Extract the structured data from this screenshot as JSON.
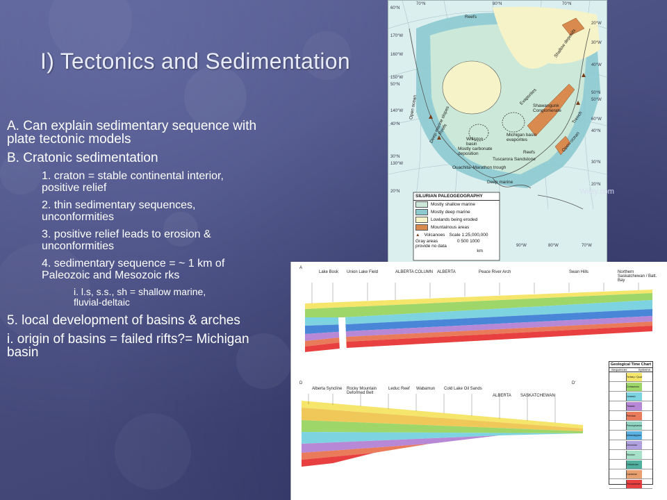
{
  "slide": {
    "title": "I) Tectonics and Sedimentation",
    "credit": "Wiley.com"
  },
  "body": {
    "point_a": "A. Can explain sedimentary sequence with plate tectonic models",
    "point_b": "B. Cratonic sedimentation",
    "sub_1": "1. craton = stable continental interior, positive relief",
    "sub_2": "2. thin sedimentary sequences, unconformities",
    "sub_3": "3. positive relief leads to erosion & unconformities",
    "sub_4": "4. sedimentary sequence = ~ 1 km of Paleozoic and Mesozoic rks",
    "sub_4_i": "i. l.s, s.s., sh = shallow marine, fluvial-deltaic",
    "point_5": "5. local development of basins & arches",
    "point_i": "i. origin of basins = failed rifts?= Michigan basin"
  },
  "map": {
    "legend_title": "SILURIAN PALEOGEOGRAPHY",
    "legend_items": [
      {
        "label": "Mostly shallow marine",
        "color": "#cbe8d8"
      },
      {
        "label": "Mostly deep marine",
        "color": "#8ccad0"
      },
      {
        "label": "Lowlands being eroded",
        "color": "#f7f3c8"
      },
      {
        "label": "Mountainous areas",
        "color": "#d98a4e"
      }
    ],
    "legend_volcanoes": "Volcanoes",
    "legend_gray": "Gray areas provide no data",
    "legend_scale": "Scale 1:25,000,000",
    "legend_scale_ticks": "0   500   1000",
    "legend_scale_unit": "km",
    "labels": {
      "reefs_top": "Reefs",
      "shallow_deposits": "Shallow deposits",
      "evaporites": "Evaporites",
      "shawangunk": "Shawangunk Conglomerate",
      "williston": "Williston basin",
      "michigan": "Michigan basin evaporites",
      "carbonate": "Mostly carbonate deposition",
      "tuscarora": "Tuscarora Sandstone",
      "ouachita": "Ouachita–Marathon trough",
      "deep_marine": "Deep marine",
      "open_ocean_left": "Open ocean",
      "open_ocean_right": "Open ocean",
      "deep_slopes": "Deep marine slopes",
      "reefs_mid": "Reefs",
      "reefs_low": "Reefs",
      "trench": "Trench"
    },
    "lat_left": [
      "60°N",
      "170°W",
      "160°W",
      "150°W",
      "50°N",
      "140°W",
      "40°N",
      "30°N",
      "130°W",
      "20°N"
    ],
    "lat_right": [
      "20°W",
      "30°W",
      "40°W",
      "50°N",
      "50°W",
      "60°W",
      "40°N",
      "30°N",
      "20°N"
    ],
    "lon_top": [
      "70°N",
      "80°N",
      "70°N"
    ],
    "lon_bottom": [
      "90°W",
      "80°W",
      "70°W"
    ]
  },
  "cross_section": {
    "label_a": "A",
    "label_d": "D",
    "label_d_prime": "D'",
    "chart_title": "Geological Time Chart",
    "chart_col1": "Sequences",
    "chart_col2": "Systems",
    "chart_units": [
      {
        "name": "Tertiary / Quaternary",
        "color": "#f5e66b"
      },
      {
        "name": "Cretaceous",
        "color": "#9ed66a"
      },
      {
        "name": "Jurassic",
        "color": "#7dd4e0"
      },
      {
        "name": "Triassic",
        "color": "#b788d6"
      },
      {
        "name": "Permian",
        "color": "#e97a5a"
      },
      {
        "name": "Pennsylvanian",
        "color": "#8fd3c0"
      },
      {
        "name": "Mississippian",
        "color": "#5ab0e0"
      },
      {
        "name": "Devonian",
        "color": "#b0a0e0"
      },
      {
        "name": "Silurian",
        "color": "#a6e0c8"
      },
      {
        "name": "Ordovician",
        "color": "#52b0a0"
      },
      {
        "name": "Cambrian",
        "color": "#e8a070"
      },
      {
        "name": "Precambrian",
        "color": "#e84040"
      }
    ],
    "top_names_a": [
      "Lake Bosk",
      "Union Lake Field",
      "ALBERTA COLUMN",
      "ALBERTA",
      "Peace River Arch",
      "Swan Hills",
      "Northern Saskatchewan / Batt. Bay"
    ],
    "top_names_d": [
      "Alberta Syncline",
      "Rocky Mountain Deformed Belt",
      "Leduc Reef",
      "Wabamun",
      "Cold Lake Oil Sands",
      "ALBERTA",
      "SASKATCHEWAN"
    ]
  }
}
